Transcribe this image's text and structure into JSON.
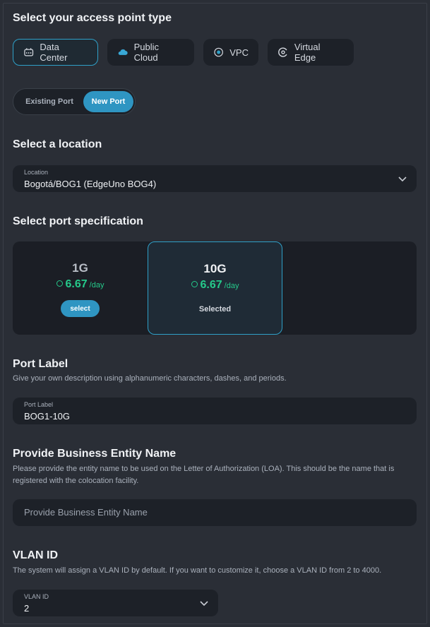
{
  "access_point": {
    "heading": "Select your access point type",
    "types": [
      {
        "label": "Data Center",
        "icon": "data-center-icon",
        "active": true
      },
      {
        "label": "Public Cloud",
        "icon": "cloud-icon",
        "active": false
      },
      {
        "label": "VPC",
        "icon": "vpc-icon",
        "active": false
      },
      {
        "label": "Virtual Edge",
        "icon": "virtual-edge-icon",
        "active": false
      }
    ]
  },
  "port_toggle": {
    "existing": "Existing Port",
    "new": "New Port",
    "selected": "New Port"
  },
  "location": {
    "heading": "Select a location",
    "field_label": "Location",
    "value": "Bogotá/BOG1 (EdgeUno BOG4)"
  },
  "port_spec": {
    "heading": "Select port specification",
    "options": [
      {
        "title": "1G",
        "amount": "6.67",
        "unit": "/day",
        "action": "select"
      },
      {
        "title": "10G",
        "amount": "6.67",
        "unit": "/day",
        "status": "Selected"
      }
    ]
  },
  "port_label": {
    "heading": "Port Label",
    "description": "Give your own description using alphanumeric characters, dashes, and periods.",
    "field_label": "Port Label",
    "value": "BOG1-10G"
  },
  "business_entity": {
    "heading": "Provide Business Entity Name",
    "description_line1": "Please provide the entity name to be used on the Letter of Authorization (LOA). This should be the name that is",
    "description_line2": "registered with the colocation facility.",
    "placeholder": "Provide Business Entity Name"
  },
  "vlan": {
    "heading": "VLAN ID",
    "description": "The system will assign a VLAN ID by default. If you want to customize it, choose a VLAN ID from 2 to 4000.",
    "field_label": "VLAN ID",
    "value": "2"
  },
  "colors": {
    "accent": "#2f95c2",
    "price_green": "#25c98a",
    "background": "#2a2e36",
    "card": "#1d2128"
  }
}
